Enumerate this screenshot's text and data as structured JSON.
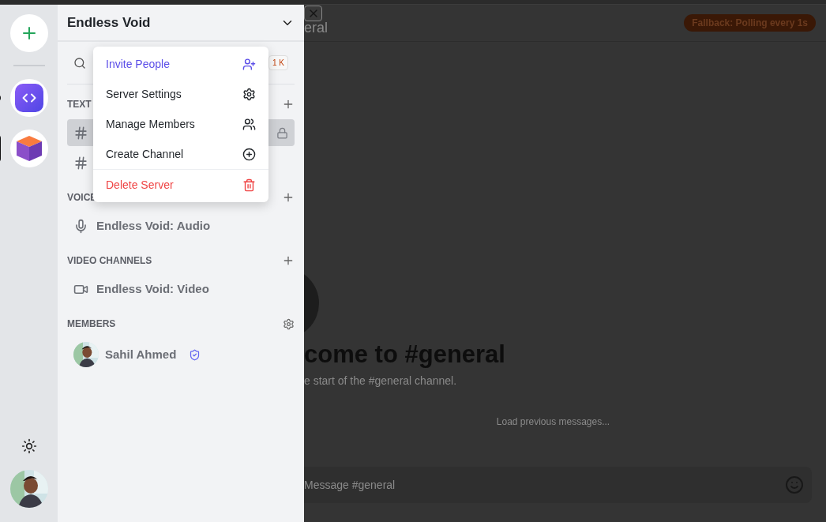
{
  "rail": {
    "servers": [
      {
        "kind": "code",
        "selected": false
      },
      {
        "kind": "cube",
        "selected": true
      }
    ]
  },
  "server": {
    "name": "Endless Void",
    "search": {
      "shortcut": "1 K"
    },
    "sections": [
      {
        "title": "TEXT",
        "channels": [
          {
            "kind": "text",
            "selected": true,
            "locked": true
          },
          {
            "kind": "text",
            "selected": false,
            "locked": false
          }
        ]
      },
      {
        "title": "VOICE",
        "channels": [
          {
            "kind": "voice",
            "name": "Endless Void: Audio",
            "selected": false,
            "locked": false
          }
        ]
      },
      {
        "title": "VIDEO CHANNELS",
        "channels": [
          {
            "kind": "video",
            "name": "Endless Void: Video",
            "selected": false,
            "locked": false
          }
        ]
      }
    ],
    "members_title": "MEMBERS",
    "members": [
      {
        "name": "Sahil Ahmed",
        "verified": true
      }
    ]
  },
  "menu": [
    {
      "label": "Invite People",
      "kind": "accent"
    },
    {
      "label": "Server Settings",
      "kind": "default"
    },
    {
      "label": "Manage Members",
      "kind": "default"
    },
    {
      "label": "Create Channel",
      "kind": "default"
    },
    {
      "label": "Delete Server",
      "kind": "danger"
    }
  ],
  "chat": {
    "header": "eral",
    "status_badge": "Fallback: Polling every 1s",
    "welcome": "come to #general",
    "subtitle": "e start of the #general channel.",
    "load_more": "Load previous messages...",
    "input": {
      "placeholder": "Message #general"
    }
  }
}
